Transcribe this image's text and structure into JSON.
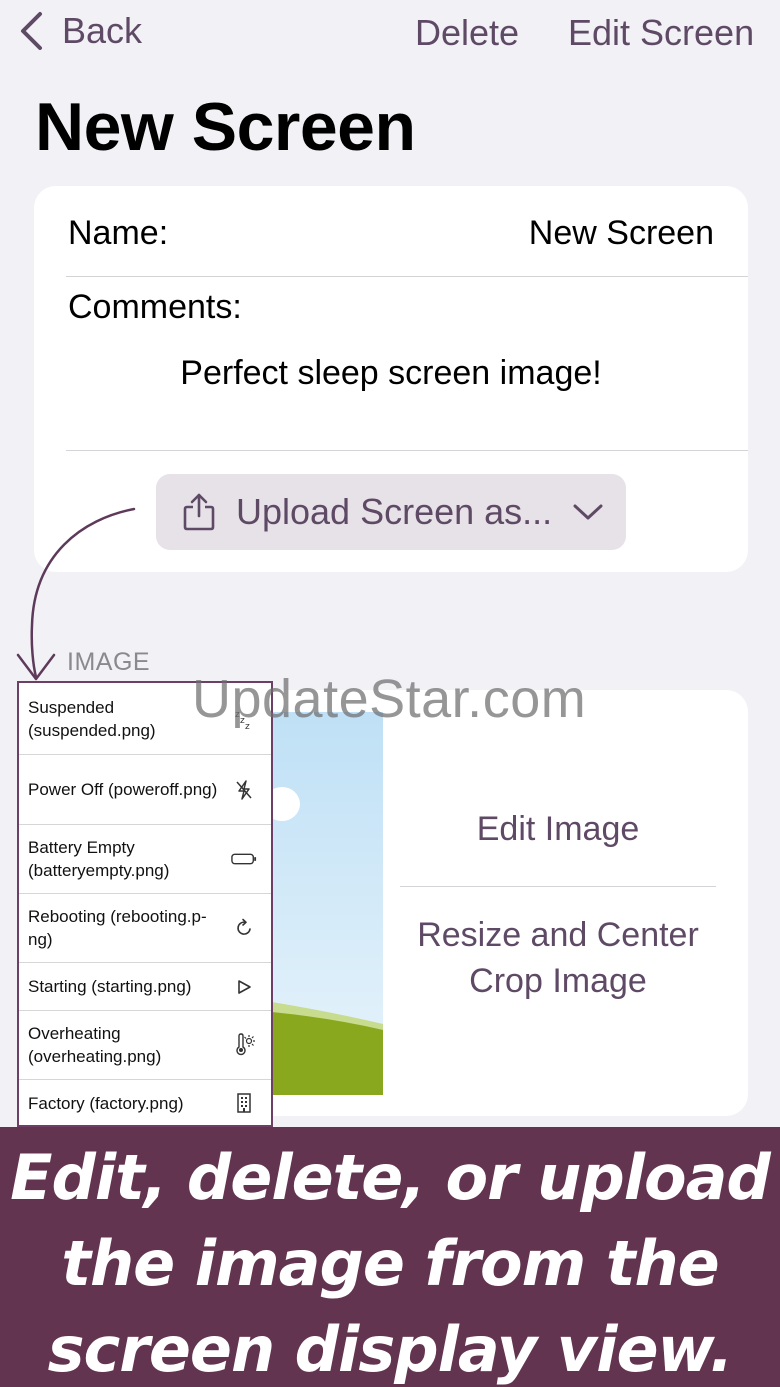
{
  "nav": {
    "back_label": "Back",
    "delete_label": "Delete",
    "edit_screen_label": "Edit Screen"
  },
  "page_title": "New Screen",
  "details": {
    "name_label": "Name:",
    "name_value": "New Screen",
    "comments_label": "Comments:",
    "comments_value": "Perfect sleep screen image!",
    "upload_label": "Upload Screen as..."
  },
  "image_section": {
    "label": "IMAGE",
    "edit_image_label": "Edit Image",
    "resize_label": "Resize and Center Crop Image"
  },
  "upload_menu": [
    {
      "label": "Suspended (suspended.png)",
      "icon": "zzz-icon"
    },
    {
      "label": "Power Off (poweroff.png)",
      "icon": "power-off-icon"
    },
    {
      "label": "Battery Empty (batteryempty.png)",
      "icon": "battery-empty-icon"
    },
    {
      "label": "Rebooting (rebooting.p-ng)",
      "icon": "reboot-icon"
    },
    {
      "label": "Starting (starting.png)",
      "icon": "play-icon"
    },
    {
      "label": "Overheating (overheating.png)",
      "icon": "thermometer-sun-icon"
    },
    {
      "label": "Factory (factory.png)",
      "icon": "building-icon"
    }
  ],
  "watermark": "UpdateStar.com",
  "banner_text": "Edit, delete, or upload the image from the screen display view.",
  "colors": {
    "accent": "#5f4a66",
    "banner": "#63344f",
    "menu_border": "#6e3f66",
    "background": "#f2f1f6"
  }
}
